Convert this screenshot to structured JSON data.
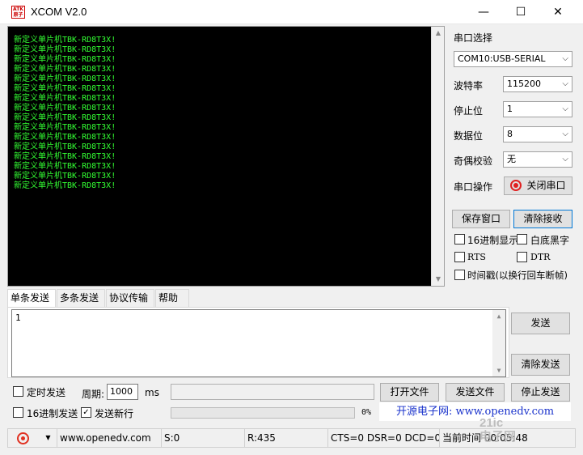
{
  "window": {
    "title": "XCOM V2.0",
    "logo_text": "ATK 原子",
    "minimize": "—",
    "maximize": "☐",
    "close": "✕"
  },
  "receive": {
    "line": "新定义单片机TBK-RD8T3X!",
    "line_count": 16
  },
  "port_panel": {
    "port_select_label": "串口选择",
    "port_value": "COM10:USB-SERIAL",
    "baud_label": "波特率",
    "baud_value": "115200",
    "stopbit_label": "停止位",
    "stopbit_value": "1",
    "databit_label": "数据位",
    "databit_value": "8",
    "parity_label": "奇偶校验",
    "parity_value": "无",
    "op_label": "串口操作",
    "close_port_button": "关闭串口",
    "save_window_button": "保存窗口",
    "clear_receive_button": "清除接收",
    "hex_display_label": "16进制显示",
    "hex_display_checked": false,
    "white_bg_label": "白底黑字",
    "white_bg_checked": false,
    "rts_label": "RTS",
    "rts_checked": false,
    "dtr_label": "DTR",
    "dtr_checked": false,
    "timestamp_label": "时间戳(以换行回车断帧)",
    "timestamp_checked": false
  },
  "tabs": [
    "单条发送",
    "多条发送",
    "协议传输",
    "帮助"
  ],
  "send": {
    "text": "1",
    "send_button": "发送",
    "clear_send_button": "清除发送",
    "timed_send_label": "定时发送",
    "timed_send_checked": false,
    "period_label": "周期:",
    "period_value": "1000",
    "period_unit": "ms",
    "open_file_button": "打开文件",
    "send_file_button": "发送文件",
    "stop_send_button": "停止发送",
    "hex_send_label": "16进制发送",
    "hex_send_checked": false,
    "newline_label": "发送新行",
    "newline_checked": true,
    "progress_text": "0%",
    "progress": 0,
    "ad_text": "开源电子网: www.openedv.com"
  },
  "statusbar": {
    "url": "www.openedv.com",
    "sent": "S:0",
    "received": "R:435",
    "lines": "CTS=0 DSR=0 DCD=0",
    "time": "当前时间 00:05:48"
  },
  "watermark": "21ic 电子网",
  "colors": {
    "receive_bg": "#000000",
    "receive_text": "#33ff33",
    "ad_text": "#1a33cc",
    "port_icon": "#e02020"
  }
}
